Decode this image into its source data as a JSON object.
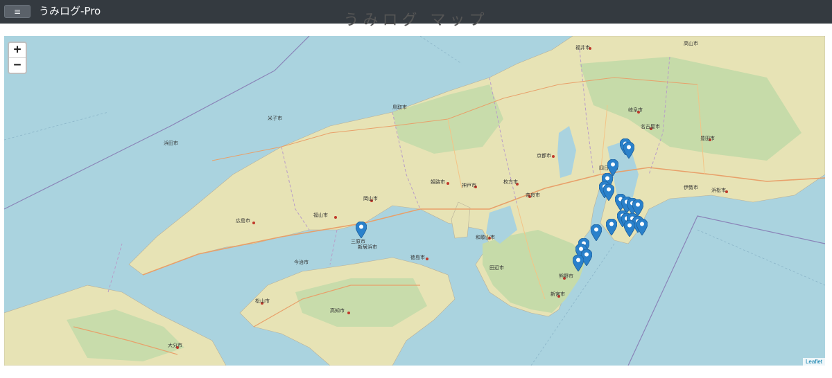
{
  "navbar": {
    "menu_icon": "hamburger-icon",
    "brand": "うみログ-Pro"
  },
  "page": {
    "title": "うみログ マップ"
  },
  "map": {
    "zoom_in": "+",
    "zoom_out": "−",
    "attribution": "Leaflet",
    "colors": {
      "sea": "#aad3df",
      "land": "#e7e3b5",
      "forest": "#b9d7a4",
      "marker": "#2a81cb"
    },
    "cities": [
      {
        "name": "福井市"
      },
      {
        "name": "高山市"
      },
      {
        "name": "岐阜市"
      },
      {
        "name": "名古屋市"
      },
      {
        "name": "豊田市"
      },
      {
        "name": "京都市"
      },
      {
        "name": "枚方市"
      },
      {
        "name": "奈良市"
      },
      {
        "name": "神戸市"
      },
      {
        "name": "姫路市"
      },
      {
        "name": "岡山市"
      },
      {
        "name": "福山市"
      },
      {
        "name": "広島市"
      },
      {
        "name": "松山市"
      },
      {
        "name": "高知市"
      },
      {
        "name": "徳島市"
      },
      {
        "name": "和歌山市"
      },
      {
        "name": "浜松市"
      },
      {
        "name": "大分市"
      },
      {
        "name": "新宮市"
      },
      {
        "name": "熊野市"
      },
      {
        "name": "鳥取市"
      },
      {
        "name": "米子市"
      },
      {
        "name": "浜田市"
      },
      {
        "name": "三原市"
      },
      {
        "name": "今治市"
      },
      {
        "name": "新居浜市"
      },
      {
        "name": "伊勢市"
      },
      {
        "name": "四日市市"
      },
      {
        "name": "田辺市"
      }
    ],
    "markers": [
      {
        "site": "marker"
      },
      {
        "site": "marker"
      },
      {
        "site": "marker"
      },
      {
        "site": "marker"
      },
      {
        "site": "marker"
      },
      {
        "site": "marker"
      },
      {
        "site": "marker"
      },
      {
        "site": "marker"
      },
      {
        "site": "marker"
      },
      {
        "site": "marker"
      },
      {
        "site": "marker"
      },
      {
        "site": "marker"
      },
      {
        "site": "marker"
      },
      {
        "site": "marker"
      },
      {
        "site": "marker"
      },
      {
        "site": "marker"
      },
      {
        "site": "marker"
      },
      {
        "site": "marker"
      },
      {
        "site": "marker"
      },
      {
        "site": "marker"
      },
      {
        "site": "marker"
      },
      {
        "site": "marker"
      },
      {
        "site": "marker"
      }
    ]
  }
}
